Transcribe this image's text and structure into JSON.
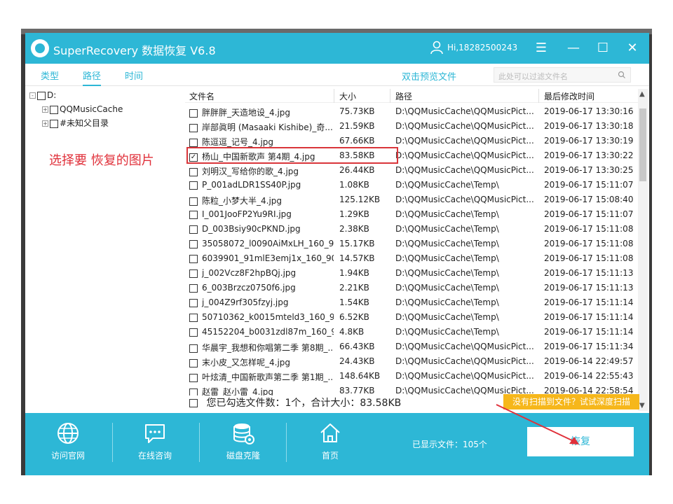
{
  "window": {
    "title": "SuperRecovery 数据恢复 V6.8",
    "user": "Hi,18282500243",
    "menu_icon": "☰",
    "minimize_icon": "—",
    "maximize_icon": "☐",
    "close_icon": "✕"
  },
  "toolbar": {
    "tabs": [
      {
        "label": "类型",
        "active": false
      },
      {
        "label": "路径",
        "active": true
      },
      {
        "label": "时间",
        "active": false
      }
    ],
    "preview_link": "双击预览文件",
    "search_placeholder": "此处可以过滤文件名"
  },
  "tree": {
    "root": "D:",
    "children": [
      "QQMusicCache",
      "#未知父目录"
    ],
    "expander": "-",
    "child_expander": "+"
  },
  "annotation": "选择要 恢复的图片",
  "table": {
    "headers": [
      "文件名",
      "大小",
      "路径",
      "最后修改时间"
    ],
    "rows": [
      {
        "name": "胖胖胖_天造地设_4.jpg",
        "size": "75.73KB",
        "path": "D:\\QQMusicCache\\QQMusicPict...",
        "time": "2019-06-17 13:30:16",
        "checked": false
      },
      {
        "name": "岸部眞明 (Masaaki Kishibe)_奇...",
        "size": "21.59KB",
        "path": "D:\\QQMusicCache\\QQMusicPict...",
        "time": "2019-06-17 13:30:18",
        "checked": false
      },
      {
        "name": "陈逗逗_记号_4.jpg",
        "size": "67.66KB",
        "path": "D:\\QQMusicCache\\QQMusicPict...",
        "time": "2019-06-17 13:30:19",
        "checked": false
      },
      {
        "name": "杨山_中国新歌声 第4期_4.jpg",
        "size": "83.58KB",
        "path": "D:\\QQMusicCache\\QQMusicPict...",
        "time": "2019-06-17 13:30:22",
        "checked": true
      },
      {
        "name": "刘明汉_写给你的歌_4.jpg",
        "size": "26.44KB",
        "path": "D:\\QQMusicCache\\QQMusicPict...",
        "time": "2019-06-17 13:30:25",
        "checked": false
      },
      {
        "name": "P_001adLDR1SS40P.jpg",
        "size": "1.08KB",
        "path": "D:\\QQMusicCache\\Temp\\",
        "time": "2019-06-17 15:11:07",
        "checked": false
      },
      {
        "name": "陈粒_小梦大半_4.jpg",
        "size": "125.12KB",
        "path": "D:\\QQMusicCache\\QQMusicPict...",
        "time": "2019-06-17 15:08:40",
        "checked": false
      },
      {
        "name": "I_001JooFP2Yu9RI.jpg",
        "size": "1.29KB",
        "path": "D:\\QQMusicCache\\Temp\\",
        "time": "2019-06-17 15:11:07",
        "checked": false
      },
      {
        "name": "D_003Bsiy90cPKND.jpg",
        "size": "2.38KB",
        "path": "D:\\QQMusicCache\\Temp\\",
        "time": "2019-06-17 15:11:08",
        "checked": false
      },
      {
        "name": "35058072_l0090AiMxLH_160_9...",
        "size": "15.17KB",
        "path": "D:\\QQMusicCache\\Temp\\",
        "time": "2019-06-17 15:11:08",
        "checked": false
      },
      {
        "name": "6039901_91mlE3emj1x_160_90...",
        "size": "14.57KB",
        "path": "D:\\QQMusicCache\\Temp\\",
        "time": "2019-06-17 15:11:08",
        "checked": false
      },
      {
        "name": "j_002Vcz8F2hpBQj.jpg",
        "size": "1.94KB",
        "path": "D:\\QQMusicCache\\Temp\\",
        "time": "2019-06-17 15:11:13",
        "checked": false
      },
      {
        "name": "6_003Brzcz0750f6.jpg",
        "size": "2.21KB",
        "path": "D:\\QQMusicCache\\Temp\\",
        "time": "2019-06-17 15:11:13",
        "checked": false
      },
      {
        "name": "j_004Z9rf305fzyj.jpg",
        "size": "1.54KB",
        "path": "D:\\QQMusicCache\\Temp\\",
        "time": "2019-06-17 15:11:14",
        "checked": false
      },
      {
        "name": "50710362_k0015mteld3_160_9...",
        "size": "6.52KB",
        "path": "D:\\QQMusicCache\\Temp\\",
        "time": "2019-06-17 15:11:14",
        "checked": false
      },
      {
        "name": "45152204_b0031zdl87m_160_9...",
        "size": "4.8KB",
        "path": "D:\\QQMusicCache\\Temp\\",
        "time": "2019-06-17 15:11:14",
        "checked": false
      },
      {
        "name": "华晨宇_我想和你唱第二季 第8期_...",
        "size": "66.43KB",
        "path": "D:\\QQMusicCache\\QQMusicPict...",
        "time": "2019-06-17 15:11:34",
        "checked": false
      },
      {
        "name": "末小皮_又怎样呢_4.jpg",
        "size": "24.43KB",
        "path": "D:\\QQMusicCache\\QQMusicPict...",
        "time": "2019-06-14 22:49:57",
        "checked": false
      },
      {
        "name": "叶炫清_中国新歌声第二季 第1期_...",
        "size": "148.64KB",
        "path": "D:\\QQMusicCache\\QQMusicPict...",
        "time": "2019-06-14 22:55:43",
        "checked": false
      },
      {
        "name": "赵雷_赵小雷_4.jpg",
        "size": "83.77KB",
        "path": "D:\\QQMusicCache\\QQMusicPict...",
        "time": "2019-06-14 22:58:54",
        "checked": false
      }
    ]
  },
  "summary": "您已勾选文件数：1个，合计大小：83.58KB",
  "deep_scan_link": "没有扫描到文件？试试深度扫描",
  "bottom_bar": {
    "items": [
      {
        "label": "访问官网",
        "icon": "globe-icon"
      },
      {
        "label": "在线咨询",
        "icon": "chat-icon"
      },
      {
        "label": "磁盘克隆",
        "icon": "disk-clone-icon"
      },
      {
        "label": "首页",
        "icon": "home-icon"
      }
    ],
    "shown_count": "已显示文件：105个",
    "restore_button": "恢复"
  },
  "colors": {
    "accent": "#2db7d6",
    "annotation_red": "#e0303a",
    "deep_scan": "#f6b71b"
  }
}
